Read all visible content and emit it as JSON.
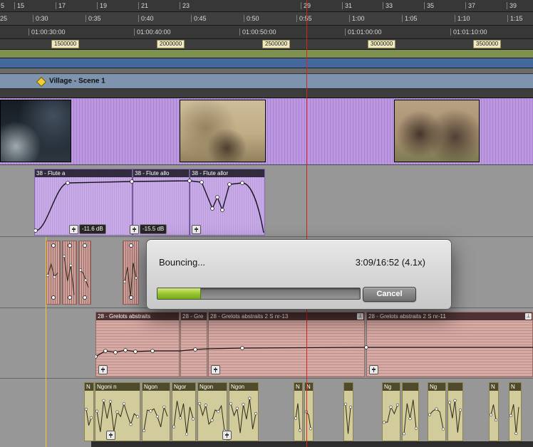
{
  "rulers": {
    "bars_labels": [
      "5",
      "15",
      "17",
      "19",
      "21",
      "23",
      "29",
      "31",
      "33",
      "35",
      "37",
      "39"
    ],
    "minsec_labels": [
      "25",
      "0:30",
      "0:35",
      "0:40",
      "0:45",
      "0:50",
      "0:55",
      "1:00",
      "1:05",
      "1:10",
      "1:15"
    ],
    "timecode_labels": [
      "01:00:30:00",
      "01:00:40:00",
      "01:00:50:00",
      "01:01:00:00",
      "01:01:10:00"
    ],
    "samples_labels": [
      "1500000",
      "2000000",
      "2500000",
      "3000000",
      "3500000"
    ]
  },
  "marker": {
    "label": "Village - Scene 1"
  },
  "flute": {
    "clips": [
      {
        "label": "38 - Flute a"
      },
      {
        "label": "38 - Flute allo"
      },
      {
        "label": "38 - Flute allor"
      }
    ],
    "badges": [
      "-11.6 dB",
      "-15.5 dB"
    ]
  },
  "grelots": {
    "clips": [
      {
        "label": "28 - Grelots abstraits"
      },
      {
        "label": "28 - Gre"
      },
      {
        "label": "28 - Grelots abstraits 2 S nr-13"
      },
      {
        "label": "28 - Grelots abstraits 2 S nr-11"
      }
    ]
  },
  "ngoni": {
    "clips": [
      {
        "label": "N"
      },
      {
        "label": "Ngoni n"
      },
      {
        "label": "Ngon"
      },
      {
        "label": "Ngor"
      },
      {
        "label": "Ngon"
      },
      {
        "label": "Ngon"
      },
      {
        "label": "N"
      },
      {
        "label": "N"
      },
      {
        "label": ""
      },
      {
        "label": "Ng"
      },
      {
        "label": ""
      },
      {
        "label": "Ng"
      },
      {
        "label": ""
      },
      {
        "label": "N"
      },
      {
        "label": "N"
      }
    ]
  },
  "dialog": {
    "title": "Bouncing...",
    "progress_text": "3:09/16:52 (4.1x)",
    "cancel_label": "Cancel",
    "progress_percent": 21
  },
  "icons": {
    "warp": "⊥"
  },
  "colors": {
    "playhead_red": "#d2251f",
    "edit_cursor_yellow": "#f2c933",
    "progress_green": "#8fbf2a",
    "video_clip_purple": "#bb98e0",
    "audio_clip_purple": "#c9abe8",
    "audio_clip_pink": "#d7aba5",
    "audio_clip_khaki": "#d2cb9b",
    "marker_yellow": "#f2cf2e"
  }
}
